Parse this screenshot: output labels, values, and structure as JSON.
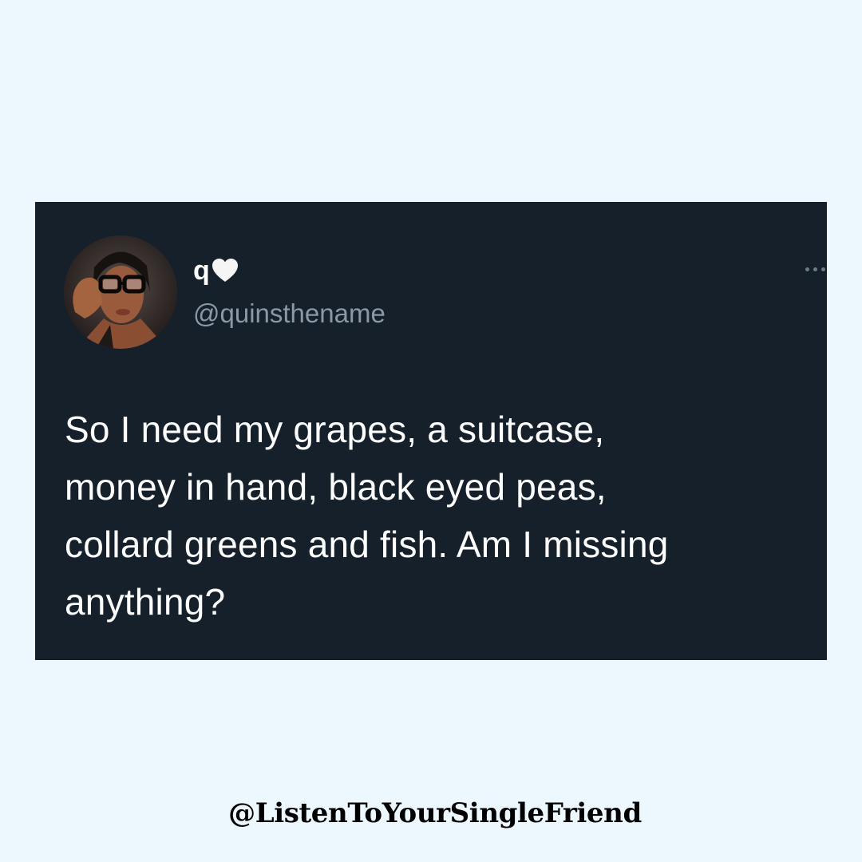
{
  "tweet": {
    "display_name": "q",
    "name_emoji": "white-heart-icon",
    "handle": "@quinsthename",
    "text_lines": [
      "So I need my grapes, a suitcase,",
      "money in hand, black eyed peas,",
      "collard greens and fish. Am I missing",
      "anything?"
    ],
    "more_icon": "more-horizontal-icon"
  },
  "watermark": "@ListenToYourSingleFriend",
  "colors": {
    "page_background": "#edf8fe",
    "card_background": "#15202b",
    "text_primary": "#ffffff",
    "text_secondary": "#8b98a5"
  }
}
